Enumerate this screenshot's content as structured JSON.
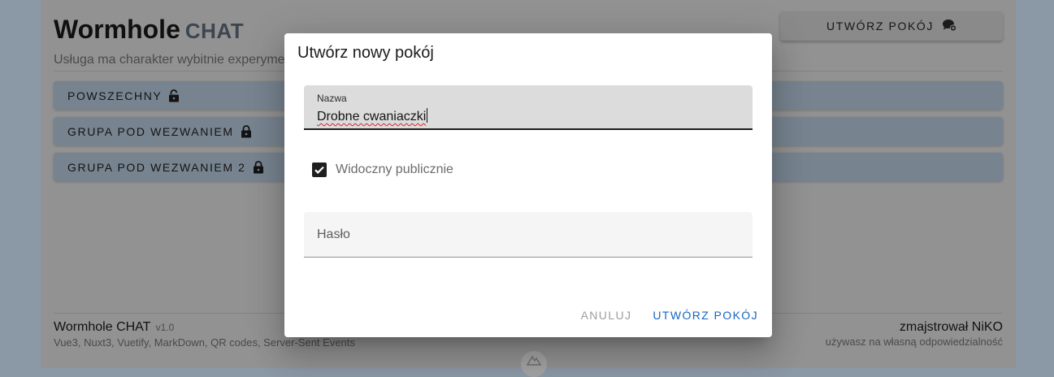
{
  "app": {
    "brand_main": "Wormhole",
    "brand_sub": "CHAT",
    "tagline": "Usługa ma charakter wybitnie experyme",
    "create_room_label": "UTWÓRZ POKÓJ"
  },
  "rooms": [
    {
      "label": "POWSZECHNY",
      "lock": "lock-open-icon"
    },
    {
      "label": "GRUPA POD WEZWANIEM",
      "lock": "lock-icon"
    },
    {
      "label": "GRUPA POD WEZWANIEM 2",
      "lock": "lock-icon"
    }
  ],
  "footer": {
    "title": "Wormhole CHAT",
    "version": "v1.0",
    "tech": "Vue3, Nuxt3, Vuetify, MarkDown, QR codes, Server-Sent Events",
    "author": "zmajstrował NiKO",
    "note": "używasz na własną odpowiedzialność"
  },
  "dialog": {
    "title": "Utwórz nowy pokój",
    "name_label": "Nazwa",
    "name_value": "Drobne cwaniaczki",
    "visible_label": "Widoczny publicznie",
    "visible_checked": true,
    "password_placeholder": "Hasło",
    "cancel_label": "ANULUJ",
    "create_label": "UTWÓRZ POKÓJ"
  },
  "colors": {
    "overlay_bg": "#929292",
    "accent": "#1565c0",
    "room_bg": "#778490"
  }
}
